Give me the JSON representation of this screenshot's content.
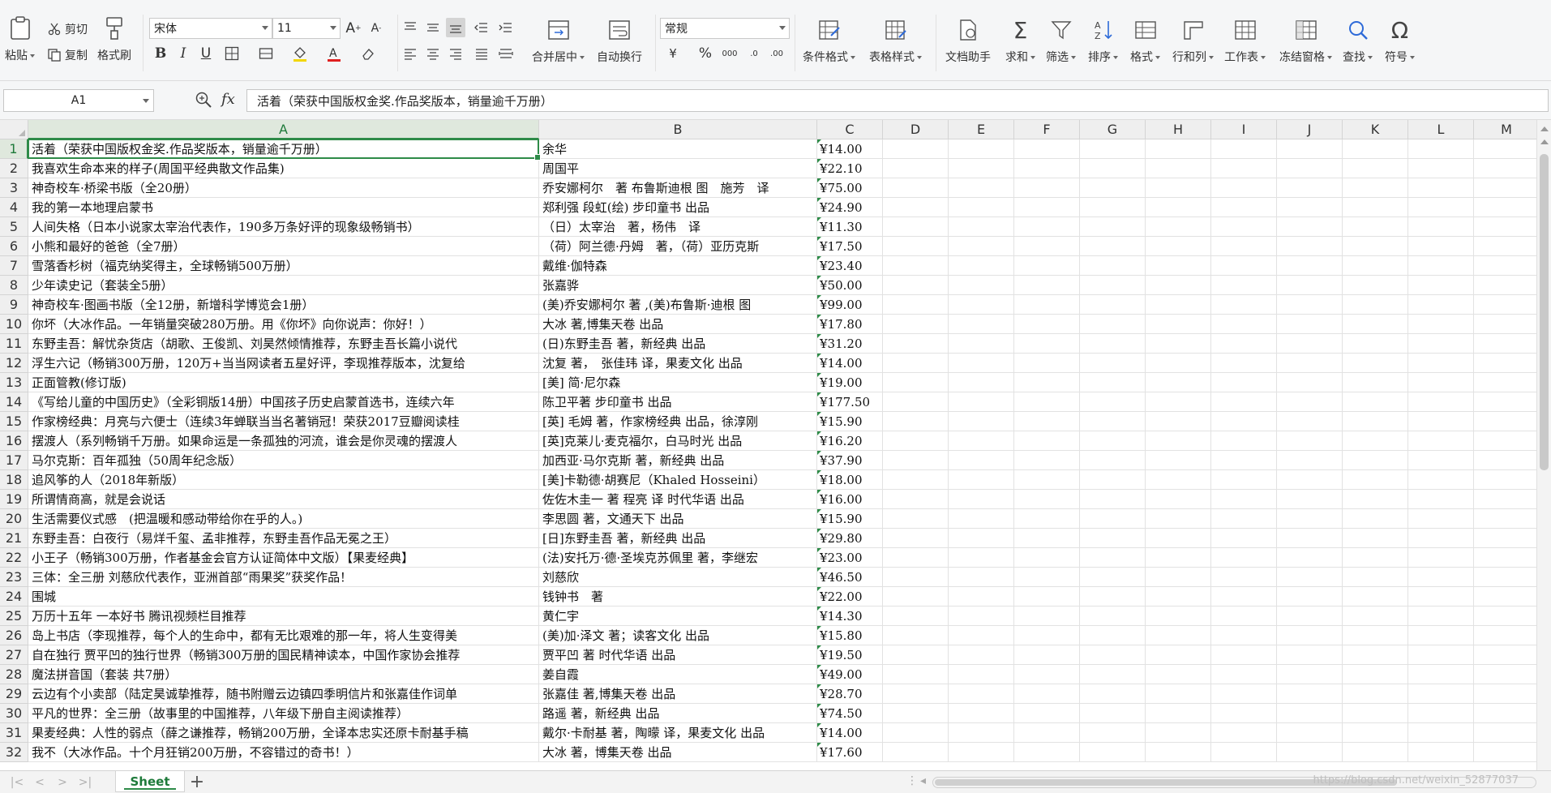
{
  "ribbon": {
    "paste_label": "粘贴",
    "cut_label": "剪切",
    "copy_label": "复制",
    "format_painter_label": "格式刷",
    "font_name": "宋体",
    "font_size": "11",
    "merge_center_label": "合并居中",
    "wrap_text_label": "自动换行",
    "number_format": "常规",
    "conditional_format_label": "条件格式",
    "table_style_label": "表格样式",
    "doc_assistant_label": "文档助手",
    "sum_label": "求和",
    "filter_label": "筛选",
    "sort_label": "排序",
    "format_label": "格式",
    "row_col_label": "行和列",
    "worksheet_label": "工作表",
    "freeze_label": "冻结窗格",
    "find_label": "查找",
    "symbol_label": "符号",
    "accent_color": "#2e8b48"
  },
  "formula_bar": {
    "name_box": "A1",
    "fx_label": "fx",
    "content": "活着（荣获中国版权金奖.作品奖版本，销量逾千万册）"
  },
  "columns": [
    "A",
    "B",
    "C",
    "D",
    "E",
    "F",
    "G",
    "H",
    "I",
    "J",
    "K",
    "L",
    "M"
  ],
  "rows": [
    {
      "n": "1",
      "a": "活着（荣获中国版权金奖.作品奖版本，销量逾千万册）",
      "b": "余华",
      "c": "¥14.00"
    },
    {
      "n": "2",
      "a": "我喜欢生命本来的样子(周国平经典散文作品集)",
      "b": "周国平",
      "c": "¥22.10"
    },
    {
      "n": "3",
      "a": "神奇校车·桥梁书版（全20册）",
      "b": "乔安娜柯尔　著 布鲁斯迪根 图　施芳　译",
      "c": "¥75.00"
    },
    {
      "n": "4",
      "a": "我的第一本地理启蒙书",
      "b": "郑利强 段虹(绘) 步印童书 出品",
      "c": "¥24.90"
    },
    {
      "n": "5",
      "a": "人间失格（日本小说家太宰治代表作，190多万条好评的现象级畅销书）",
      "b": "（日）太宰治　著，杨伟　译",
      "c": "¥11.30"
    },
    {
      "n": "6",
      "a": "小熊和最好的爸爸（全7册）",
      "b": "（荷）阿兰德·丹姆　著，（荷）亚历克斯",
      "c": "¥17.50"
    },
    {
      "n": "7",
      "a": "雪落香杉树（福克纳奖得主，全球畅销500万册）",
      "b": "戴维·伽特森",
      "c": "¥23.40"
    },
    {
      "n": "8",
      "a": "少年读史记（套装全5册）",
      "b": "张嘉骅",
      "c": "¥50.00"
    },
    {
      "n": "9",
      "a": "神奇校车·图画书版（全12册，新增科学博览会1册）",
      "b": "(美)乔安娜柯尔 著 ,(美)布鲁斯·迪根 图",
      "c": "¥99.00"
    },
    {
      "n": "10",
      "a": "你坏（大冰作品。一年销量突破280万册。用《你坏》向你说声：你好！）",
      "b": "大冰 著,博集天卷 出品",
      "c": "¥17.80"
    },
    {
      "n": "11",
      "a": "东野圭吾：解忧杂货店（胡歌、王俊凯、刘昊然倾情推荐，东野圭吾长篇小说代",
      "b": "(日)东野圭吾 著，新经典 出品",
      "c": "¥31.20"
    },
    {
      "n": "12",
      "a": "浮生六记（畅销300万册，120万+当当网读者五星好评，李现推荐版本，沈复给",
      "b": "沈复 著，　张佳玮 译，果麦文化 出品",
      "c": "¥14.00"
    },
    {
      "n": "13",
      "a": "正面管教(修订版)",
      "b": "[美] 简·尼尔森",
      "c": "¥19.00"
    },
    {
      "n": "14",
      "a": "《写给儿童的中国历史》（全彩铜版14册）中国孩子历史启蒙首选书，连续六年",
      "b": "陈卫平著 步印童书 出品",
      "c": "¥177.50"
    },
    {
      "n": "15",
      "a": "作家榜经典：月亮与六便士（连续3年蝉联当当名著销冠！荣获2017豆瓣阅读桂",
      "b": "[英] 毛姆 著，作家榜经典 出品，徐淳刚",
      "c": "¥15.90"
    },
    {
      "n": "16",
      "a": "摆渡人（系列畅销千万册。如果命运是一条孤独的河流，谁会是你灵魂的摆渡人",
      "b": "[英]克莱儿·麦克福尔，白马时光 出品",
      "c": "¥16.20"
    },
    {
      "n": "17",
      "a": "马尔克斯：百年孤独（50周年纪念版）",
      "b": "加西亚·马尔克斯 著，新经典 出品",
      "c": "¥37.90"
    },
    {
      "n": "18",
      "a": "追风筝的人（2018年新版）",
      "b": "[美]卡勒德·胡赛尼（Khaled Hosseini）",
      "c": "¥18.00"
    },
    {
      "n": "19",
      "a": "所谓情商高，就是会说话",
      "b": "佐佐木圭一 著 程亮 译 时代华语 出品",
      "c": "¥16.00"
    },
    {
      "n": "20",
      "a": "生活需要仪式感　(把温暖和感动带给你在乎的人。)",
      "b": "李思圆 著，文通天下 出品",
      "c": "¥15.90"
    },
    {
      "n": "21",
      "a": "东野圭吾：白夜行（易烊千玺、孟非推荐，东野圭吾作品无冕之王）",
      "b": "[日]东野圭吾 著，新经典 出品",
      "c": "¥29.80"
    },
    {
      "n": "22",
      "a": "小王子（畅销300万册，作者基金会官方认证简体中文版）【果麦经典】",
      "b": "(法)安托万·德·圣埃克苏佩里 著，李继宏",
      "c": "¥23.00"
    },
    {
      "n": "23",
      "a": "三体：全三册 刘慈欣代表作，亚洲首部“雨果奖”获奖作品！",
      "b": "刘慈欣",
      "c": "¥46.50"
    },
    {
      "n": "24",
      "a": "围城",
      "b": "钱钟书　著",
      "c": "¥22.00"
    },
    {
      "n": "25",
      "a": "万历十五年 一本好书 腾讯视频栏目推荐",
      "b": "黄仁宇",
      "c": "¥14.30"
    },
    {
      "n": "26",
      "a": "岛上书店（李现推荐，每个人的生命中，都有无比艰难的那一年，将人生变得美",
      "b": "(美)加·泽文 著；读客文化 出品",
      "c": "¥15.80"
    },
    {
      "n": "27",
      "a": "自在独行 贾平凹的独行世界（畅销300万册的国民精神读本，中国作家协会推荐",
      "b": "贾平凹 著 时代华语 出品",
      "c": "¥19.50"
    },
    {
      "n": "28",
      "a": "魔法拼音国（套装 共7册）",
      "b": "姜自霞",
      "c": "¥49.00"
    },
    {
      "n": "29",
      "a": "云边有个小卖部（陆定昊诚挚推荐，随书附赠云边镇四季明信片和张嘉佳作词单",
      "b": "张嘉佳 著,博集天卷 出品",
      "c": "¥28.70"
    },
    {
      "n": "30",
      "a": "平凡的世界：全三册（故事里的中国推荐，八年级下册自主阅读推荐）",
      "b": "路遥 著，新经典 出品",
      "c": "¥74.50"
    },
    {
      "n": "31",
      "a": "果麦经典：人性的弱点（薛之谦推荐，畅销200万册，全译本忠实还原卡耐基手稿",
      "b": "戴尔·卡耐基 著，陶曚 译，果麦文化 出品",
      "c": "¥14.00"
    },
    {
      "n": "32",
      "a": "我不（大冰作品。十个月狂销200万册，不容错过的奇书！）",
      "b": "大冰 著，博集天卷 出品",
      "c": "¥17.60"
    }
  ],
  "sheet": {
    "tab_name": "Sheet",
    "add_symbol": "+"
  },
  "watermark": "https://blog.csdn.net/weixin_52877037"
}
